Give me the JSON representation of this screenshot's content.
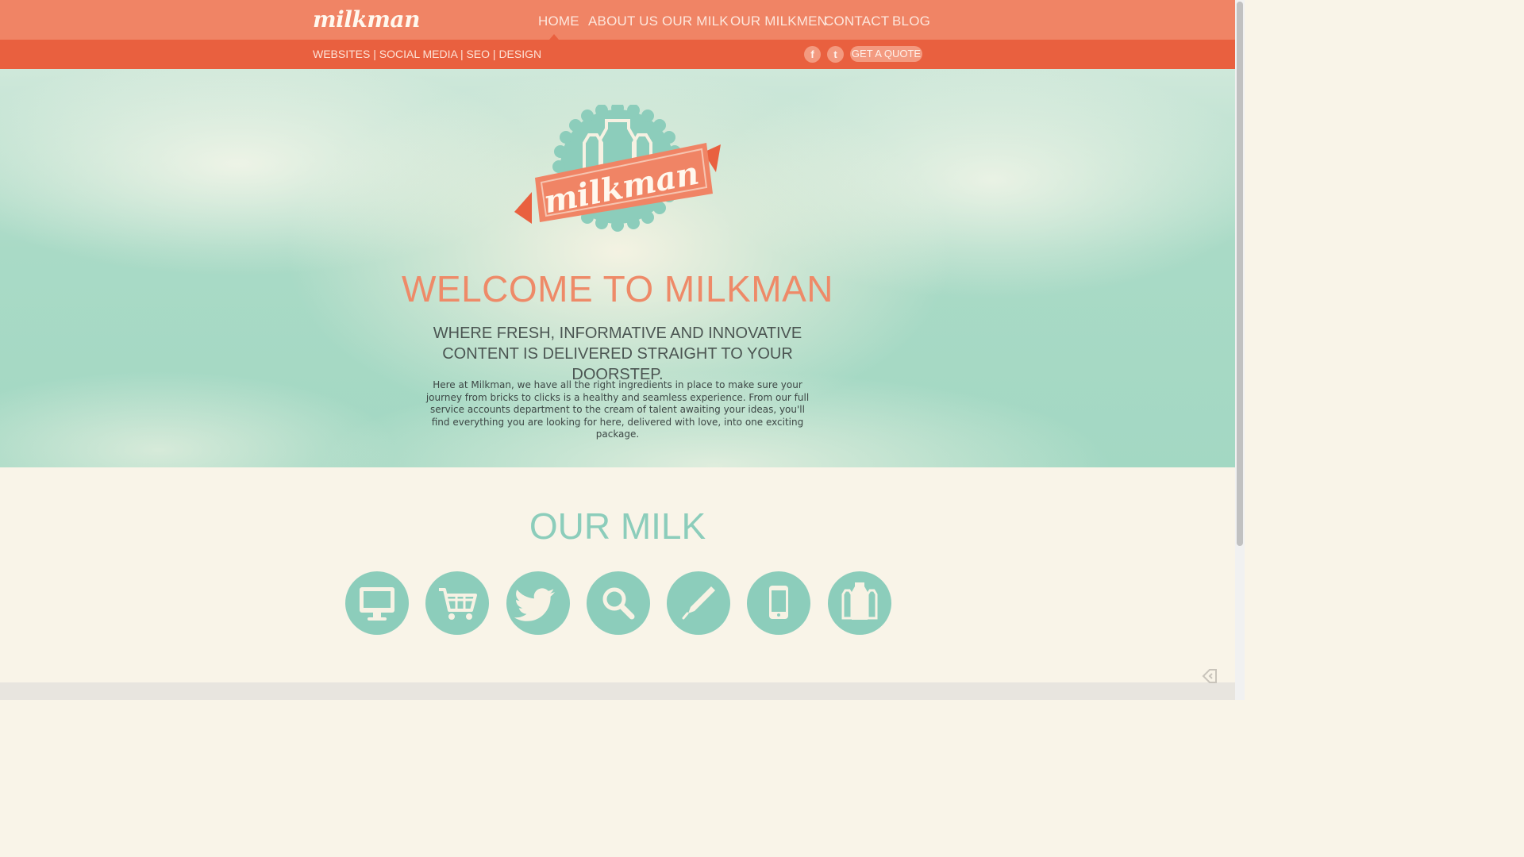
{
  "header": {
    "logo": "milkman",
    "nav": [
      {
        "label": "HOME",
        "active": true
      },
      {
        "label": "ABOUT US"
      },
      {
        "label": "OUR MILK"
      },
      {
        "label": "OUR MILKMEN"
      },
      {
        "label": "CONTACT"
      },
      {
        "label": "BLOG"
      }
    ]
  },
  "subbar": {
    "tagline": "WEBSITES | SOCIAL MEDIA | SEO | DESIGN",
    "social": [
      {
        "icon": "facebook-icon",
        "glyph": "f"
      },
      {
        "icon": "twitter-icon",
        "glyph": "t"
      }
    ],
    "quote_button": "GET A QUOTE"
  },
  "hero": {
    "badge_text": "milkman",
    "title": "WELCOME TO MILKMAN",
    "subtitle": "WHERE FRESH, INFORMATIVE AND INNOVATIVE CONTENT IS DELIVERED STRAIGHT TO YOUR DOORSTEP.",
    "intro": "Here at Milkman, we have all the right ingredients in place to make sure your journey from bricks to clicks is a healthy and seamless experience. From our full service accounts department to the cream of talent awaiting your ideas, you'll find everything you are looking for here, delivered with love, into one exciting package."
  },
  "our_milk": {
    "title": "OUR MILK",
    "services": [
      {
        "icon": "monitor-icon"
      },
      {
        "icon": "shopping-cart-icon"
      },
      {
        "icon": "twitter-bird-icon"
      },
      {
        "icon": "search-icon"
      },
      {
        "icon": "pen-icon"
      },
      {
        "icon": "mobile-phone-icon"
      },
      {
        "icon": "milk-bottles-icon"
      }
    ]
  },
  "colors": {
    "nav_bg": "#f08465",
    "subbar_bg": "#e9603f",
    "accent_teal": "#8ccdbb",
    "title_coral": "#ee8a68",
    "cream_bg": "#f9f4e8"
  }
}
